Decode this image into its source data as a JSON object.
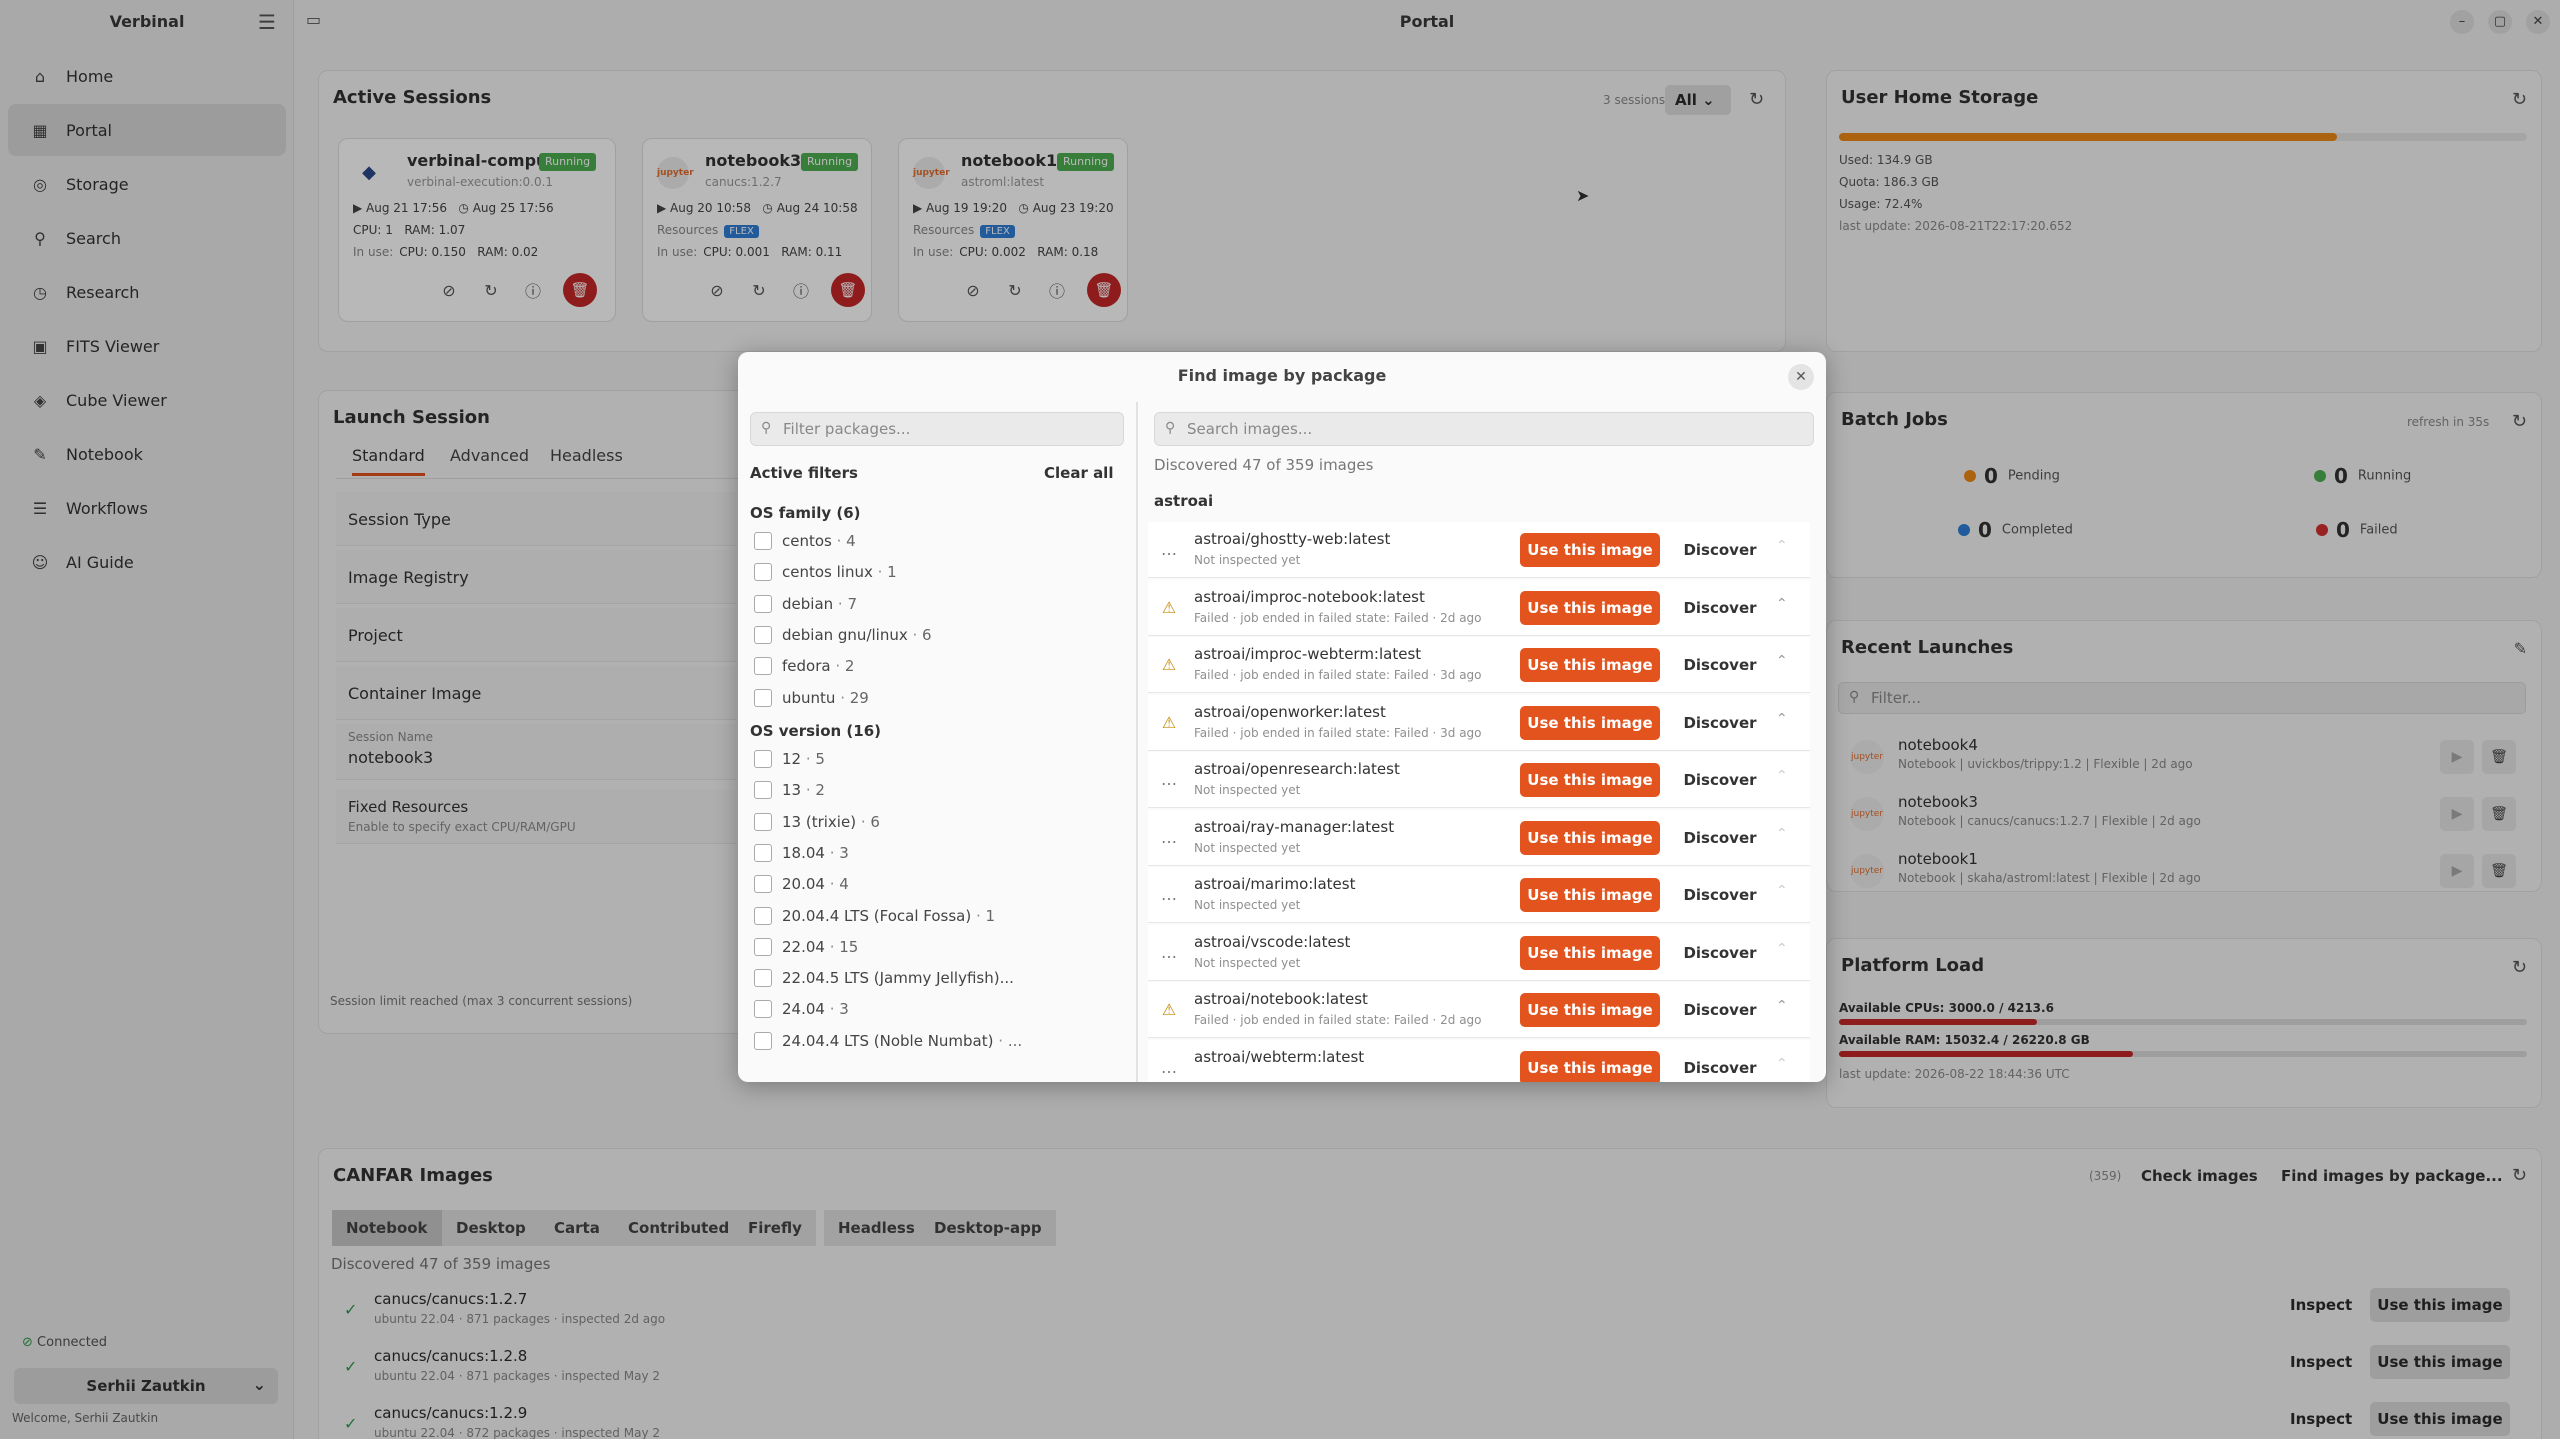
{
  "app": {
    "name": "Verbinal",
    "window_title": "Portal"
  },
  "sidebar": {
    "items": [
      {
        "label": "Home",
        "icon": "home-icon",
        "glyph": "⌂"
      },
      {
        "label": "Portal",
        "icon": "grid-icon",
        "glyph": "▦"
      },
      {
        "label": "Storage",
        "icon": "storage-icon",
        "glyph": "◎"
      },
      {
        "label": "Search",
        "icon": "search-icon",
        "glyph": "⚲"
      },
      {
        "label": "Research",
        "icon": "clock-icon",
        "glyph": "◷"
      },
      {
        "label": "FITS Viewer",
        "icon": "image-icon",
        "glyph": "▣"
      },
      {
        "label": "Cube Viewer",
        "icon": "cube-icon",
        "glyph": "◈"
      },
      {
        "label": "Notebook",
        "icon": "notebook-icon",
        "glyph": "✎"
      },
      {
        "label": "Workflows",
        "icon": "list-icon",
        "glyph": "☰"
      },
      {
        "label": "AI Guide",
        "icon": "robot-icon",
        "glyph": "☺"
      }
    ],
    "status": "Connected",
    "user": "Serhii Zautkin",
    "welcome": "Welcome, Serhii Zautkin"
  },
  "active_sessions": {
    "title": "Active Sessions",
    "count_label": "3 sessions",
    "filter": "All",
    "sessions": [
      {
        "name": "verbinal-compute",
        "status": "Running",
        "image": "verbinal-execution:0.0.1",
        "start": "Aug 21 17:56",
        "expires": "Aug 25 17:56",
        "alloc": "CPU: 1   RAM: 1.07",
        "in_use": "CPU: 0.150   RAM: 0.02"
      },
      {
        "name": "notebook3",
        "status": "Running",
        "image": "canucs:1.2.7",
        "start": "Aug 20 10:58",
        "expires": "Aug 24 10:58",
        "resources": "Resources",
        "flex": "FLEX",
        "in_use": "CPU: 0.001   RAM: 0.11"
      },
      {
        "name": "notebook1",
        "status": "Running",
        "image": "astroml:latest",
        "start": "Aug 19 19:20",
        "expires": "Aug 23 19:20",
        "resources": "Resources",
        "flex": "FLEX",
        "in_use": "CPU: 0.002   RAM: 0.18"
      }
    ],
    "in_use_label": "In use:"
  },
  "storage": {
    "title": "User Home Storage",
    "used": "Used: 134.9 GB",
    "quota": "Quota: 186.3 GB",
    "usage": "Usage: 72.4%",
    "usage_fraction": 0.724,
    "last_update": "last update: 2026-08-21T22:17:20.652",
    "bar_color": "#ef8a17"
  },
  "launch": {
    "title": "Launch Session",
    "tabs": [
      "Standard",
      "Advanced",
      "Headless"
    ],
    "fields": [
      "Session Type",
      "Image Registry",
      "Project",
      "Container Image"
    ],
    "session_name_label": "Session Name",
    "session_name": "notebook3",
    "fixed_resources": "Fixed Resources",
    "fixed_resources_sub": "Enable to specify exact CPU/RAM/GPU",
    "limit": "Session limit reached (max 3 concurrent sessions)"
  },
  "batch": {
    "title": "Batch Jobs",
    "refresh": "refresh in 35s",
    "pending": {
      "value": "0",
      "label": "Pending",
      "color": "#ef8a17"
    },
    "running": {
      "value": "0",
      "label": "Running",
      "color": "#4caf50"
    },
    "completed": {
      "value": "0",
      "label": "Completed",
      "color": "#2f7fd7"
    },
    "failed": {
      "value": "0",
      "label": "Failed",
      "color": "#d32f2f"
    }
  },
  "recent": {
    "title": "Recent Launches",
    "filter_placeholder": "Filter...",
    "items": [
      {
        "name": "notebook4",
        "sub": "Notebook | uvickbos/trippy:1.2 | Flexible | 2d ago"
      },
      {
        "name": "notebook3",
        "sub": "Notebook | canucs/canucs:1.2.7 | Flexible | 2d ago"
      },
      {
        "name": "notebook1",
        "sub": "Notebook | skaha/astroml:latest | Flexible | 2d ago"
      }
    ]
  },
  "platform": {
    "title": "Platform Load",
    "cpus": "Available CPUs: 3000.0 / 4213.6",
    "cpu_fraction": 0.288,
    "ram": "Available RAM: 15032.4 / 26220.8 GB",
    "ram_fraction": 0.427,
    "last_update": "last update: 2026-08-22 18:44:36 UTC"
  },
  "images": {
    "title": "CANFAR Images",
    "count": "(359)",
    "check": "Check images",
    "find": "Find images by package...",
    "tabs": [
      "Notebook",
      "Desktop",
      "Carta",
      "Contributed",
      "Firefly",
      "Headless",
      "Desktop-app"
    ],
    "discovered": "Discovered 47 of 359 images",
    "rows": [
      {
        "name": "canucs/canucs:1.2.7",
        "sub": "ubuntu 22.04 · 871 packages · inspected 2d ago"
      },
      {
        "name": "canucs/canucs:1.2.8",
        "sub": "ubuntu 22.04 · 871 packages · inspected May 2"
      },
      {
        "name": "canucs/canucs:1.2.9",
        "sub": "ubuntu 22.04 · 872 packages · inspected May 2"
      }
    ],
    "inspect": "Inspect",
    "use": "Use this image"
  },
  "modal": {
    "title": "Find image by package",
    "filter_placeholder": "Filter packages...",
    "search_placeholder": "Search images...",
    "active_filters": "Active filters",
    "clear_all": "Clear all",
    "discovered": "Discovered 47 of 359 images",
    "group": "astroai",
    "os_family_label": "OS family  (6)",
    "os_family": [
      {
        "name": "centos",
        "count": "4"
      },
      {
        "name": "centos linux",
        "count": "1"
      },
      {
        "name": "debian",
        "count": "7"
      },
      {
        "name": "debian gnu/linux",
        "count": "6"
      },
      {
        "name": "fedora",
        "count": "2"
      },
      {
        "name": "ubuntu",
        "count": "29"
      }
    ],
    "os_version_label": "OS version  (16)",
    "os_version": [
      {
        "name": "12",
        "count": "5"
      },
      {
        "name": "13",
        "count": "2"
      },
      {
        "name": "13 (trixie)",
        "count": "6"
      },
      {
        "name": "18.04",
        "count": "3"
      },
      {
        "name": "20.04",
        "count": "4"
      },
      {
        "name": "20.04.4 LTS (Focal Fossa)",
        "count": "1"
      },
      {
        "name": "22.04",
        "count": "15"
      },
      {
        "name": "22.04.5 LTS (Jammy Jellyfish)...",
        "count": ""
      },
      {
        "name": "24.04",
        "count": "3"
      },
      {
        "name": "24.04.4 LTS (Noble Numbat)",
        "count": "..."
      }
    ],
    "use": "Use this image",
    "discover": "Discover",
    "results": [
      {
        "name": "astroai/ghostty-web:latest",
        "sub": "Not inspected yet",
        "warn": false
      },
      {
        "name": "astroai/improc-notebook:latest",
        "sub": "Failed · job ended in failed state: Failed · 2d ago",
        "warn": true
      },
      {
        "name": "astroai/improc-webterm:latest",
        "sub": "Failed · job ended in failed state: Failed · 3d ago",
        "warn": true
      },
      {
        "name": "astroai/openworker:latest",
        "sub": "Failed · job ended in failed state: Failed · 3d ago",
        "warn": true
      },
      {
        "name": "astroai/openresearch:latest",
        "sub": "Not inspected yet",
        "warn": false
      },
      {
        "name": "astroai/ray-manager:latest",
        "sub": "Not inspected yet",
        "warn": false
      },
      {
        "name": "astroai/marimo:latest",
        "sub": "Not inspected yet",
        "warn": false
      },
      {
        "name": "astroai/vscode:latest",
        "sub": "Not inspected yet",
        "warn": false
      },
      {
        "name": "astroai/notebook:latest",
        "sub": "Failed · job ended in failed state: Failed · 2d ago",
        "warn": true
      },
      {
        "name": "astroai/webterm:latest",
        "sub": "",
        "warn": false
      }
    ]
  }
}
